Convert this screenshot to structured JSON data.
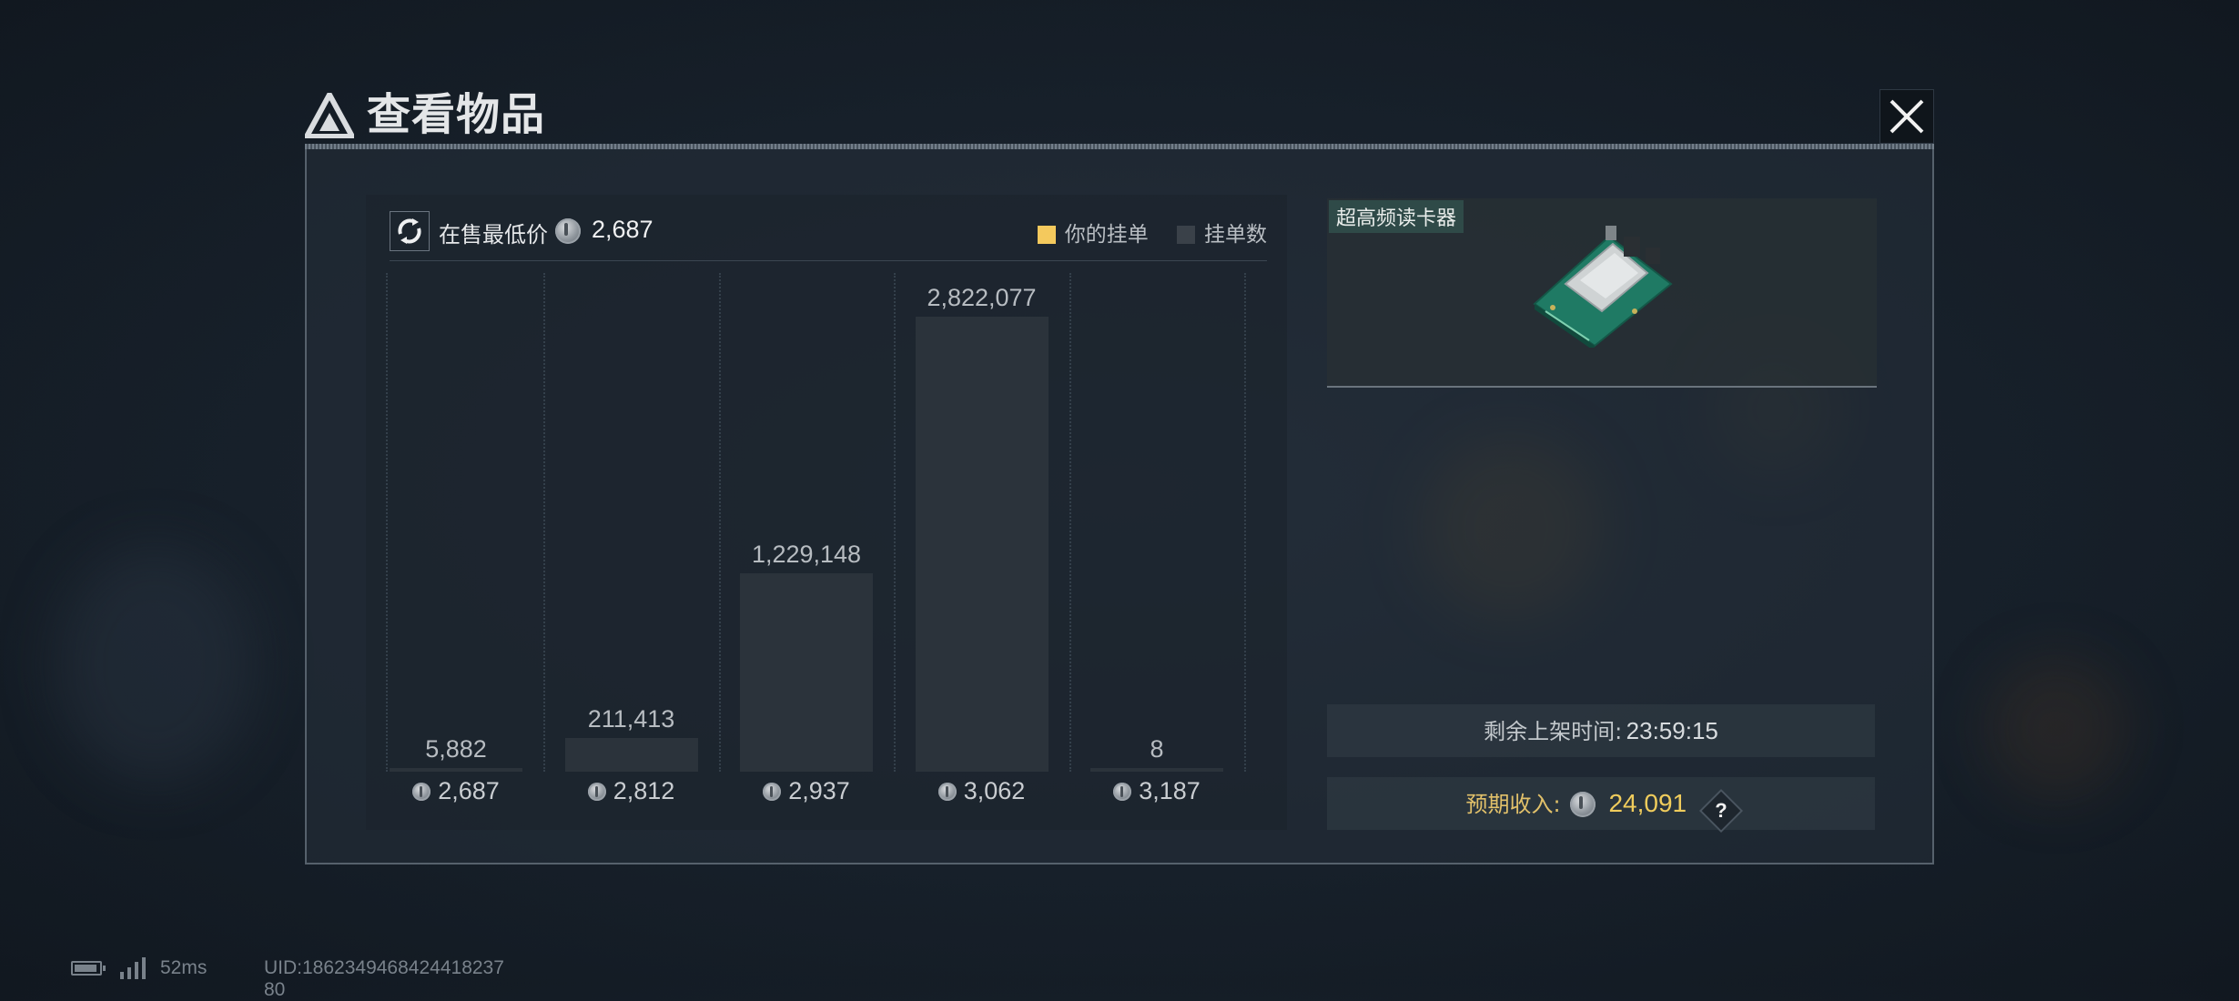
{
  "window": {
    "title": "查看物品"
  },
  "market": {
    "lowest_label": "在售最低价",
    "lowest_value": "2,687",
    "legend": {
      "yours_label": "你的挂单",
      "count_label": "挂单数"
    },
    "colors": {
      "yours": "#f4c95d",
      "count": "#3a4149"
    }
  },
  "chart_data": {
    "type": "bar",
    "categories": [
      "2,687",
      "2,812",
      "2,937",
      "3,062",
      "3,187"
    ],
    "values": [
      5882,
      211413,
      1229148,
      2822077,
      8
    ],
    "value_labels": [
      "5,882",
      "211,413",
      "1,229,148",
      "2,822,077",
      "8"
    ],
    "series": [
      {
        "name": "挂单数",
        "values": [
          5882,
          211413,
          1229148,
          2822077,
          8
        ]
      }
    ],
    "xlabel": "",
    "ylabel": "",
    "ylim": [
      0,
      2822077
    ]
  },
  "item": {
    "name": "超高频读卡器",
    "image_icon": "circuit-board-card-reader"
  },
  "listing": {
    "remaining_label": "剩余上架时间:",
    "remaining_value": "23:59:15",
    "income_label": "预期收入:",
    "income_value": "24,091",
    "help_symbol": "?"
  },
  "status_bar": {
    "ping": "52ms",
    "uid": "UID:1862349468424418237 80"
  }
}
